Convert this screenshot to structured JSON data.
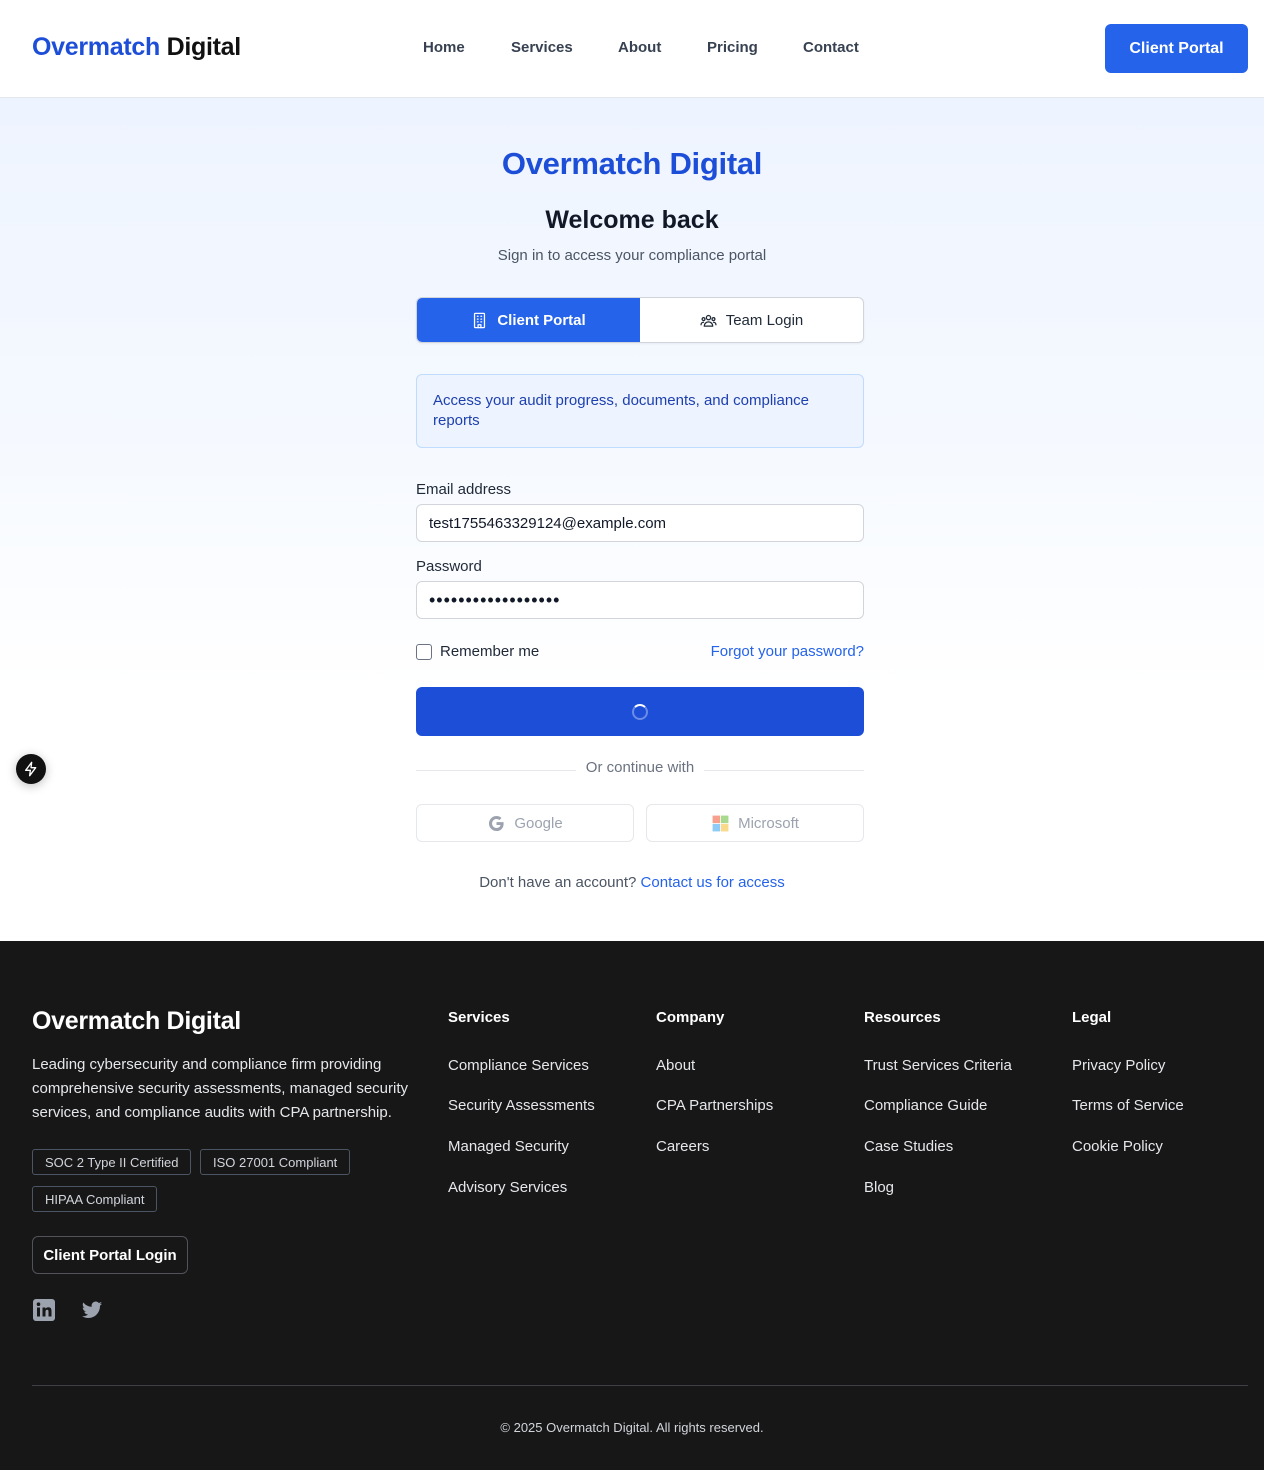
{
  "header": {
    "logo_primary": "Overmatch",
    "logo_secondary": "Digital",
    "nav": [
      "Home",
      "Services",
      "About",
      "Pricing",
      "Contact"
    ],
    "cta_label": "Client Portal"
  },
  "login": {
    "brand": "Overmatch Digital",
    "title": "Welcome back",
    "subtitle": "Sign in to access your compliance portal",
    "tabs": [
      {
        "label": "Client Portal",
        "icon": "building-icon",
        "active": true
      },
      {
        "label": "Team Login",
        "icon": "users-icon",
        "active": false
      }
    ],
    "info_text": "Access your audit progress, documents, and compliance reports",
    "email_label": "Email address",
    "email_value": "test1755463329124@example.com",
    "password_label": "Password",
    "password_value": "••••••••••••••••••",
    "remember_label": "Remember me",
    "forgot_label": "Forgot your password?",
    "submit_state": "loading",
    "divider_text": "Or continue with",
    "social": [
      {
        "label": "Google",
        "icon": "google-icon"
      },
      {
        "label": "Microsoft",
        "icon": "microsoft-icon"
      }
    ],
    "signup_prompt": "Don't have an account?",
    "signup_link": "Contact us for access"
  },
  "floating_button": {
    "icon": "lightning-icon"
  },
  "footer": {
    "brand": "Overmatch Digital",
    "description": "Leading cybersecurity and compliance firm providing comprehensive security assessments, managed security services, and compliance audits with CPA partnership.",
    "badges": [
      "SOC 2 Type II Certified",
      "ISO 27001 Compliant",
      "HIPAA Compliant"
    ],
    "portal_button": "Client Portal Login",
    "social_icons": [
      "linkedin-icon",
      "twitter-icon"
    ],
    "columns": [
      {
        "title": "Services",
        "links": [
          "Compliance Services",
          "Security Assessments",
          "Managed Security",
          "Advisory Services"
        ]
      },
      {
        "title": "Company",
        "links": [
          "About",
          "CPA Partnerships",
          "Careers"
        ]
      },
      {
        "title": "Resources",
        "links": [
          "Trust Services Criteria",
          "Compliance Guide",
          "Case Studies",
          "Blog"
        ]
      },
      {
        "title": "Legal",
        "links": [
          "Privacy Policy",
          "Terms of Service",
          "Cookie Policy"
        ]
      }
    ],
    "copyright": "© 2025 Overmatch Digital. All rights reserved."
  },
  "colors": {
    "primary": "#2563eb",
    "brand_text": "#1d4ed8",
    "footer_bg": "#171717"
  }
}
